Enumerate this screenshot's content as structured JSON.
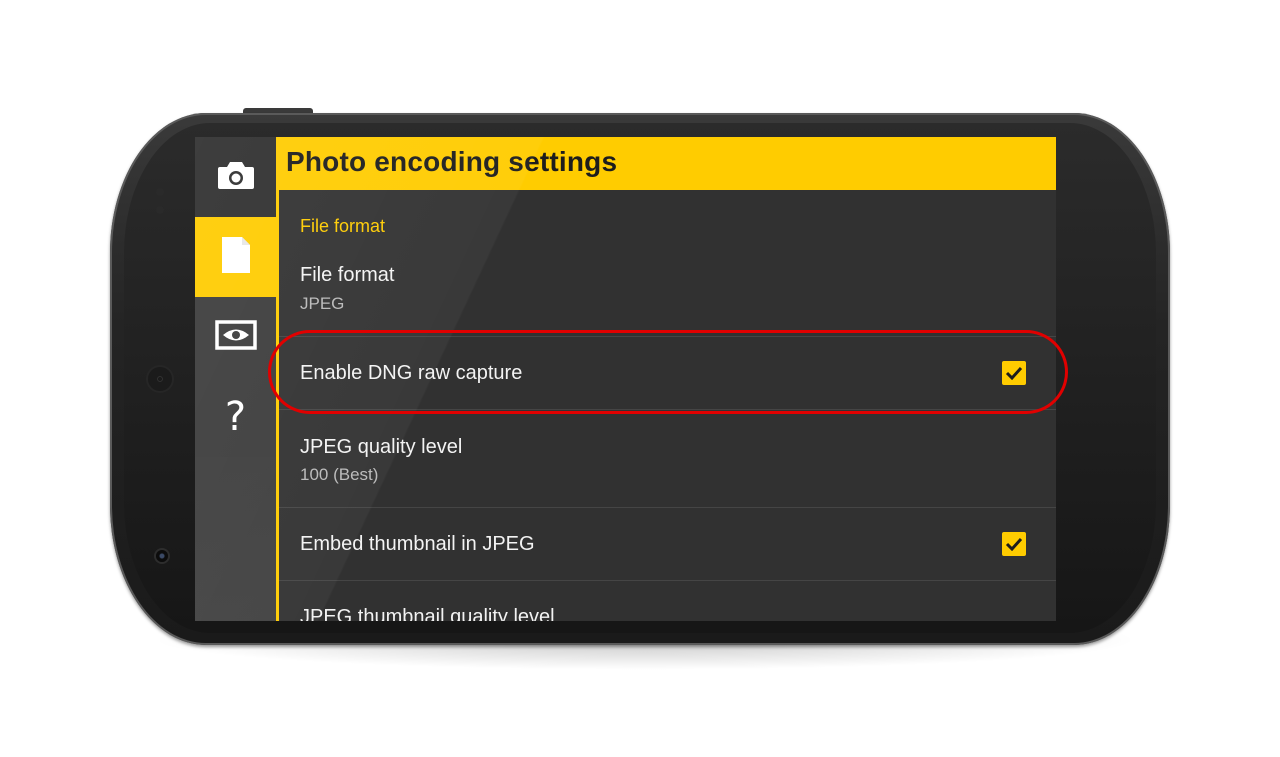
{
  "title_bar": {
    "title": "Photo encoding settings"
  },
  "sidebar": {
    "items": [
      {
        "icon": "camera-icon",
        "selected": false
      },
      {
        "icon": "file-icon",
        "selected": true
      },
      {
        "icon": "eye-icon",
        "selected": false
      },
      {
        "icon": "help-icon",
        "selected": false,
        "glyph": "?"
      }
    ]
  },
  "settings": {
    "category": "File format",
    "file_format": {
      "title": "File format",
      "value": "JPEG"
    },
    "dng_raw": {
      "title": "Enable DNG raw capture",
      "checked": true
    },
    "jpeg_quality": {
      "title": "JPEG quality level",
      "value": "100 (Best)"
    },
    "embed_thumbnail": {
      "title": "Embed thumbnail in JPEG",
      "checked": true
    },
    "thumbnail_quality": {
      "title": "JPEG thumbnail quality level"
    }
  },
  "colors": {
    "accent": "#ffcc00",
    "background": "#313131",
    "rail": "#3c3c3c",
    "highlight_annotation": "#e10000"
  }
}
